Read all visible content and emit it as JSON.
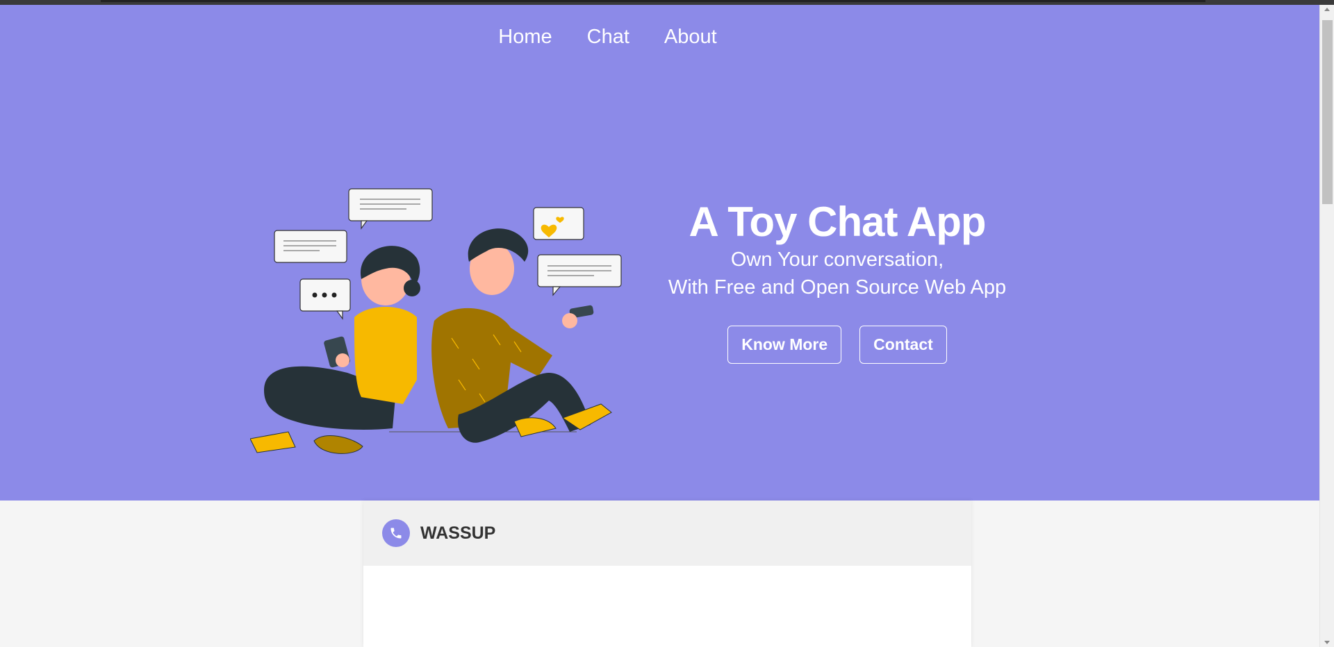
{
  "nav": {
    "items": [
      {
        "label": "Home"
      },
      {
        "label": "Chat"
      },
      {
        "label": "About"
      }
    ]
  },
  "hero": {
    "title": "A Toy Chat App",
    "subtitle_line1": "Own Your conversation,",
    "subtitle_line2": "With Free and Open Source Web App",
    "primary_button": "Know More",
    "secondary_button": "Contact"
  },
  "chat": {
    "app_name": "WASSUP",
    "icon": "phone-icon"
  },
  "colors": {
    "hero_bg": "#8c8ae8",
    "accent_yellow": "#f7b900",
    "shirt_brown": "#a07400",
    "pants_dark": "#263238"
  }
}
